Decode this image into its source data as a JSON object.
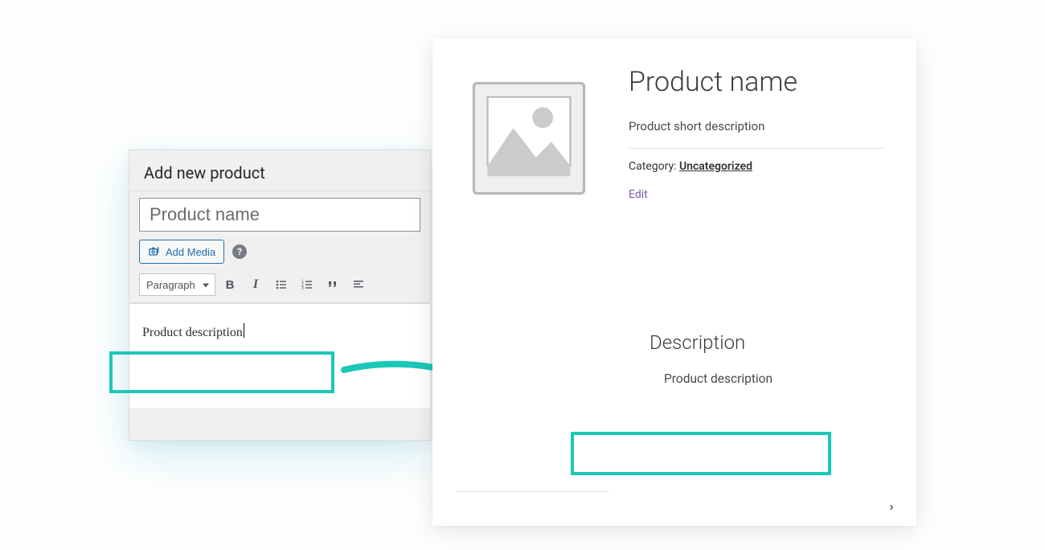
{
  "editor": {
    "heading": "Add new product",
    "title_value": "Product name",
    "add_media_label": "Add Media",
    "help_symbol": "?",
    "format_select": "Paragraph",
    "toolbar": {
      "bold": "B",
      "italic": "I",
      "ul": "≔",
      "ol": "⒈",
      "quote": "“",
      "align": "≡"
    },
    "body_text": "Product description"
  },
  "preview": {
    "title": "Product name",
    "short_desc": "Product short description",
    "category_label": "Category: ",
    "category_value": "Uncategorized",
    "edit_label": "Edit",
    "description_heading": "Description",
    "description_body": "Product description",
    "nav_symbol": "›"
  },
  "colors": {
    "accent": "#1ac8b8",
    "wp_blue": "#2271b1"
  }
}
